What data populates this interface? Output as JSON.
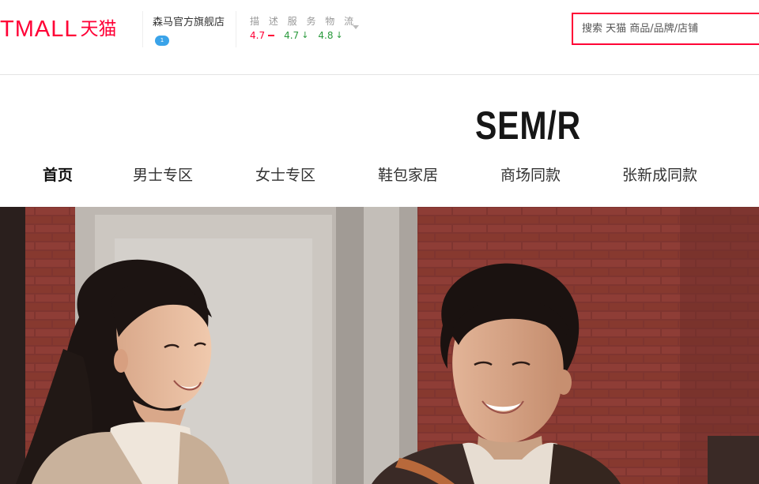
{
  "header": {
    "logo_latin": "TMALL",
    "logo_cn": "天猫",
    "shop_name": "森马官方旗舰店",
    "shop_badge": "1",
    "ratings": {
      "heads": "描 述 服 务 物 流",
      "items": [
        {
          "value": "4.7",
          "trend": "equal",
          "color": "#ff0036"
        },
        {
          "value": "4.7",
          "trend": "down",
          "color": "#2a9a3d"
        },
        {
          "value": "4.8",
          "trend": "down",
          "color": "#2a9a3d"
        }
      ]
    },
    "search": {
      "placeholder": "搜索 天猫 商品/品牌/店铺",
      "border_color": "#ff0036"
    }
  },
  "brand": {
    "logo_text": "SEM/R",
    "nav": [
      {
        "label": "首页",
        "active": true
      },
      {
        "label": "男士专区",
        "active": false
      },
      {
        "label": "女士专区",
        "active": false
      },
      {
        "label": "鞋包家居",
        "active": false
      },
      {
        "label": "商场同款",
        "active": false
      },
      {
        "label": "张新成同款",
        "active": false
      }
    ]
  },
  "hero": {
    "image": "photo of a smiling woman and man in front of a red brick wall",
    "palette": {
      "brick": "#8a3a33",
      "wall": "#c9c4bf",
      "hair": "#1c1412"
    }
  }
}
